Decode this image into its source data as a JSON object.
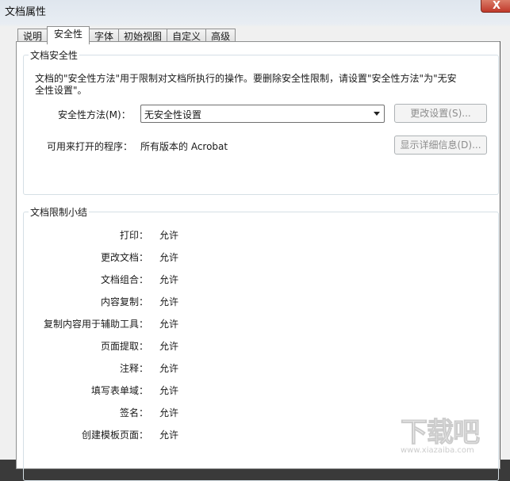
{
  "window": {
    "title": "文档属性",
    "close_label": "X"
  },
  "tabs": [
    {
      "label": "说明"
    },
    {
      "label": "安全性",
      "active": true
    },
    {
      "label": "字体"
    },
    {
      "label": "初始视图"
    },
    {
      "label": "自定义"
    },
    {
      "label": "高级"
    }
  ],
  "security": {
    "group_label": "文档安全性",
    "description": "文档的\"安全性方法\"用于限制对文档所执行的操作。要删除安全性限制，请设置\"安全性方法\"为\"无安全性设置\"。",
    "method_label": "安全性方法(M)：",
    "method_value": "无安全性设置",
    "change_settings_button": "更改设置(S)...",
    "open_with_label": "可用来打开的程序：",
    "open_with_value": "所有版本的 Acrobat",
    "show_details_button": "显示详细信息(D)..."
  },
  "summary": {
    "group_label": "文档限制小结",
    "rows": [
      {
        "key": "打印：",
        "value": "允许"
      },
      {
        "key": "更改文档：",
        "value": "允许"
      },
      {
        "key": "文档组合：",
        "value": "允许"
      },
      {
        "key": "内容复制：",
        "value": "允许"
      },
      {
        "key": "复制内容用于辅助工具：",
        "value": "允许"
      },
      {
        "key": "页面提取：",
        "value": "允许"
      },
      {
        "key": "注释：",
        "value": "允许"
      },
      {
        "key": "填写表单域：",
        "value": "允许"
      },
      {
        "key": "签名：",
        "value": "允许"
      },
      {
        "key": "创建模板页面：",
        "value": "允许"
      }
    ]
  },
  "watermark": {
    "logo": "下载吧",
    "url": "www.xiazaiba.com"
  }
}
